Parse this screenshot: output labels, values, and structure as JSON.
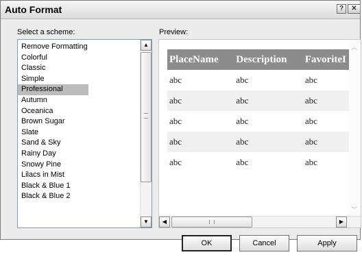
{
  "window": {
    "title": "Auto Format",
    "help_glyph": "?",
    "close_glyph": "✕"
  },
  "scheme_label": "Select a scheme:",
  "preview_label": "Preview:",
  "schemes": {
    "items": [
      {
        "label": "Remove Formatting"
      },
      {
        "label": "Colorful"
      },
      {
        "label": "Classic"
      },
      {
        "label": "Simple"
      },
      {
        "label": "Professional",
        "selected": true
      },
      {
        "label": "Autumn"
      },
      {
        "label": "Oceanica"
      },
      {
        "label": "Brown Sugar"
      },
      {
        "label": "Slate"
      },
      {
        "label": "Sand & Sky"
      },
      {
        "label": "Rainy Day"
      },
      {
        "label": "Snowy Pine"
      },
      {
        "label": "Lilacs in Mist"
      },
      {
        "label": "Black & Blue 1"
      },
      {
        "label": "Black & Blue 2"
      }
    ]
  },
  "preview_table": {
    "columns": [
      "PlaceName",
      "Description",
      "FavoriteI"
    ],
    "rows": [
      [
        "abc",
        "abc",
        "abc"
      ],
      [
        "abc",
        "abc",
        "abc"
      ],
      [
        "abc",
        "abc",
        "abc"
      ],
      [
        "abc",
        "abc",
        "abc"
      ],
      [
        "abc",
        "abc",
        "abc"
      ]
    ],
    "header_color": "#8c8c8c",
    "alt_row_color": "#f0f0f0"
  },
  "buttons": {
    "ok": "OK",
    "cancel": "Cancel",
    "apply": "Apply"
  },
  "icons": {
    "up": "up-arrow-icon",
    "down": "down-arrow-icon",
    "left": "left-arrow-icon",
    "right": "right-arrow-icon"
  },
  "selection_color": "#bcbcbc"
}
